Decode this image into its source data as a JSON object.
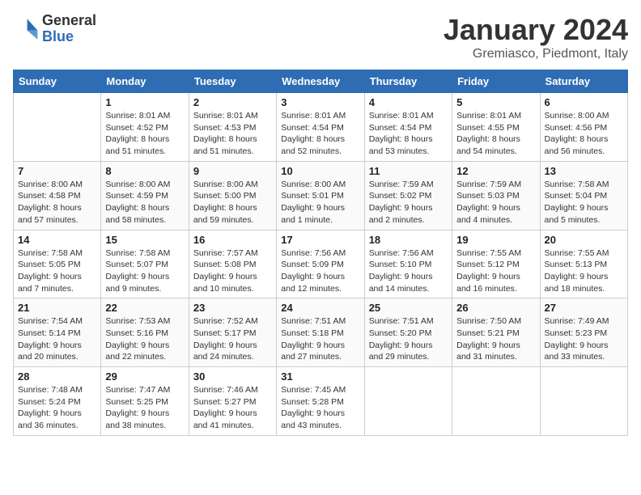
{
  "header": {
    "logo_general": "General",
    "logo_blue": "Blue",
    "title": "January 2024",
    "location": "Gremiasco, Piedmont, Italy"
  },
  "columns": [
    "Sunday",
    "Monday",
    "Tuesday",
    "Wednesday",
    "Thursday",
    "Friday",
    "Saturday"
  ],
  "weeks": [
    [
      {
        "date": "",
        "info": ""
      },
      {
        "date": "1",
        "info": "Sunrise: 8:01 AM\nSunset: 4:52 PM\nDaylight: 8 hours\nand 51 minutes."
      },
      {
        "date": "2",
        "info": "Sunrise: 8:01 AM\nSunset: 4:53 PM\nDaylight: 8 hours\nand 51 minutes."
      },
      {
        "date": "3",
        "info": "Sunrise: 8:01 AM\nSunset: 4:54 PM\nDaylight: 8 hours\nand 52 minutes."
      },
      {
        "date": "4",
        "info": "Sunrise: 8:01 AM\nSunset: 4:54 PM\nDaylight: 8 hours\nand 53 minutes."
      },
      {
        "date": "5",
        "info": "Sunrise: 8:01 AM\nSunset: 4:55 PM\nDaylight: 8 hours\nand 54 minutes."
      },
      {
        "date": "6",
        "info": "Sunrise: 8:00 AM\nSunset: 4:56 PM\nDaylight: 8 hours\nand 56 minutes."
      }
    ],
    [
      {
        "date": "7",
        "info": "Sunrise: 8:00 AM\nSunset: 4:58 PM\nDaylight: 8 hours\nand 57 minutes."
      },
      {
        "date": "8",
        "info": "Sunrise: 8:00 AM\nSunset: 4:59 PM\nDaylight: 8 hours\nand 58 minutes."
      },
      {
        "date": "9",
        "info": "Sunrise: 8:00 AM\nSunset: 5:00 PM\nDaylight: 8 hours\nand 59 minutes."
      },
      {
        "date": "10",
        "info": "Sunrise: 8:00 AM\nSunset: 5:01 PM\nDaylight: 9 hours\nand 1 minute."
      },
      {
        "date": "11",
        "info": "Sunrise: 7:59 AM\nSunset: 5:02 PM\nDaylight: 9 hours\nand 2 minutes."
      },
      {
        "date": "12",
        "info": "Sunrise: 7:59 AM\nSunset: 5:03 PM\nDaylight: 9 hours\nand 4 minutes."
      },
      {
        "date": "13",
        "info": "Sunrise: 7:58 AM\nSunset: 5:04 PM\nDaylight: 9 hours\nand 5 minutes."
      }
    ],
    [
      {
        "date": "14",
        "info": "Sunrise: 7:58 AM\nSunset: 5:05 PM\nDaylight: 9 hours\nand 7 minutes."
      },
      {
        "date": "15",
        "info": "Sunrise: 7:58 AM\nSunset: 5:07 PM\nDaylight: 9 hours\nand 9 minutes."
      },
      {
        "date": "16",
        "info": "Sunrise: 7:57 AM\nSunset: 5:08 PM\nDaylight: 9 hours\nand 10 minutes."
      },
      {
        "date": "17",
        "info": "Sunrise: 7:56 AM\nSunset: 5:09 PM\nDaylight: 9 hours\nand 12 minutes."
      },
      {
        "date": "18",
        "info": "Sunrise: 7:56 AM\nSunset: 5:10 PM\nDaylight: 9 hours\nand 14 minutes."
      },
      {
        "date": "19",
        "info": "Sunrise: 7:55 AM\nSunset: 5:12 PM\nDaylight: 9 hours\nand 16 minutes."
      },
      {
        "date": "20",
        "info": "Sunrise: 7:55 AM\nSunset: 5:13 PM\nDaylight: 9 hours\nand 18 minutes."
      }
    ],
    [
      {
        "date": "21",
        "info": "Sunrise: 7:54 AM\nSunset: 5:14 PM\nDaylight: 9 hours\nand 20 minutes."
      },
      {
        "date": "22",
        "info": "Sunrise: 7:53 AM\nSunset: 5:16 PM\nDaylight: 9 hours\nand 22 minutes."
      },
      {
        "date": "23",
        "info": "Sunrise: 7:52 AM\nSunset: 5:17 PM\nDaylight: 9 hours\nand 24 minutes."
      },
      {
        "date": "24",
        "info": "Sunrise: 7:51 AM\nSunset: 5:18 PM\nDaylight: 9 hours\nand 27 minutes."
      },
      {
        "date": "25",
        "info": "Sunrise: 7:51 AM\nSunset: 5:20 PM\nDaylight: 9 hours\nand 29 minutes."
      },
      {
        "date": "26",
        "info": "Sunrise: 7:50 AM\nSunset: 5:21 PM\nDaylight: 9 hours\nand 31 minutes."
      },
      {
        "date": "27",
        "info": "Sunrise: 7:49 AM\nSunset: 5:23 PM\nDaylight: 9 hours\nand 33 minutes."
      }
    ],
    [
      {
        "date": "28",
        "info": "Sunrise: 7:48 AM\nSunset: 5:24 PM\nDaylight: 9 hours\nand 36 minutes."
      },
      {
        "date": "29",
        "info": "Sunrise: 7:47 AM\nSunset: 5:25 PM\nDaylight: 9 hours\nand 38 minutes."
      },
      {
        "date": "30",
        "info": "Sunrise: 7:46 AM\nSunset: 5:27 PM\nDaylight: 9 hours\nand 41 minutes."
      },
      {
        "date": "31",
        "info": "Sunrise: 7:45 AM\nSunset: 5:28 PM\nDaylight: 9 hours\nand 43 minutes."
      },
      {
        "date": "",
        "info": ""
      },
      {
        "date": "",
        "info": ""
      },
      {
        "date": "",
        "info": ""
      }
    ]
  ]
}
